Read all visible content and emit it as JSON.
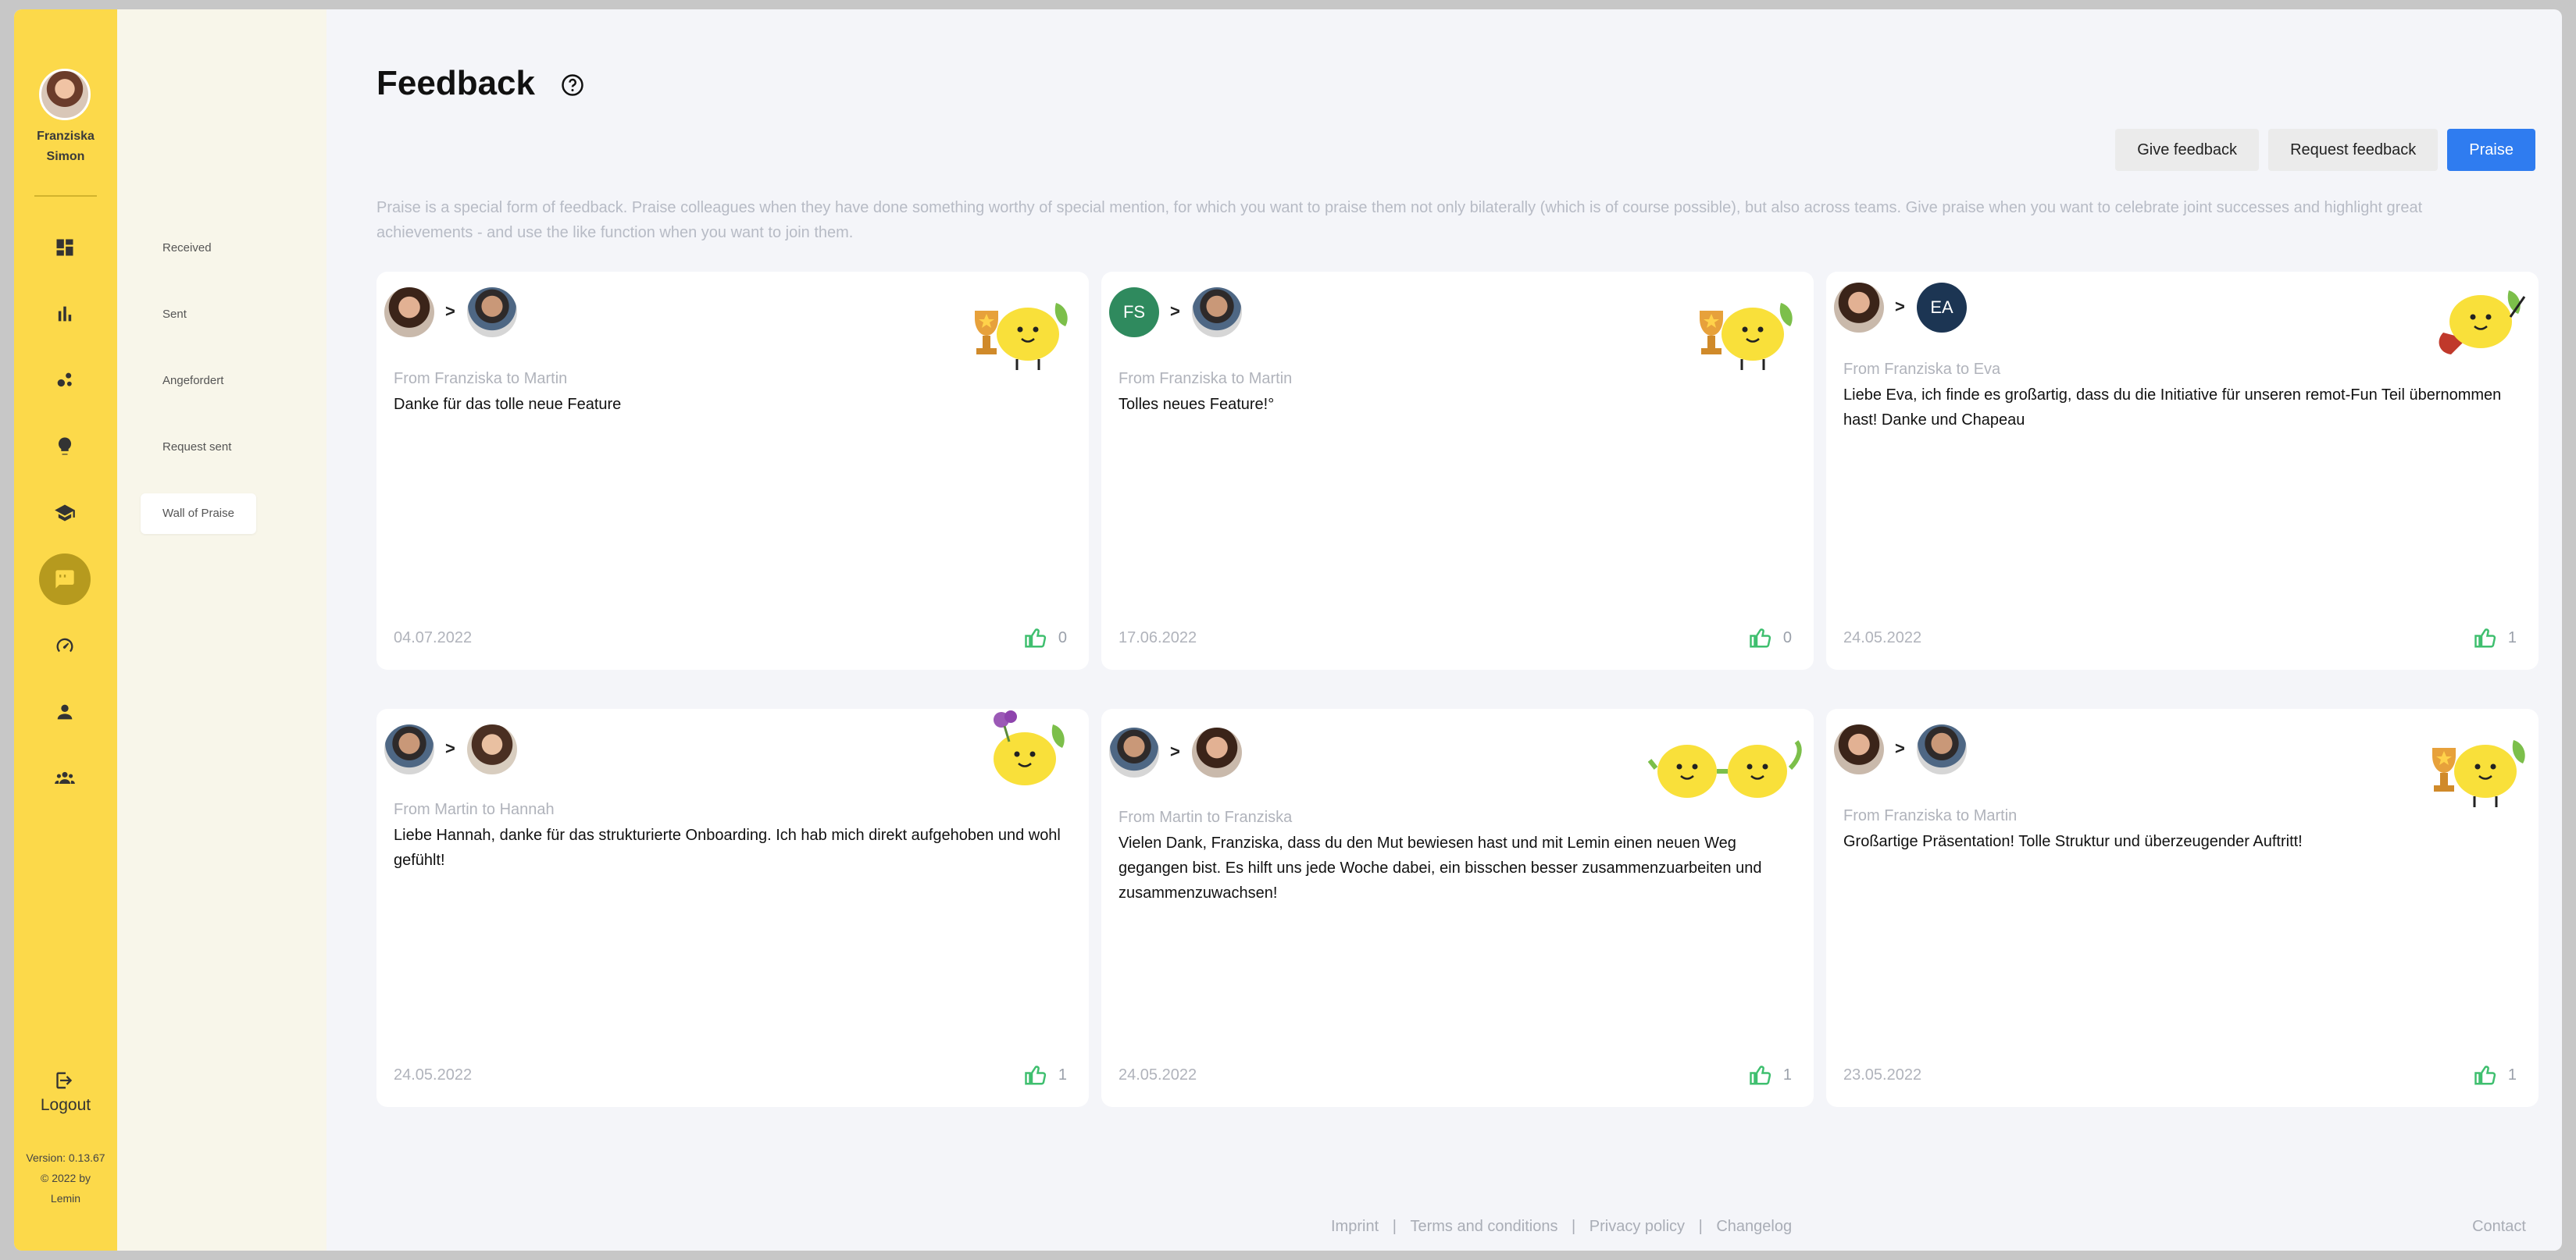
{
  "user": {
    "name_line1": "Franziska",
    "name_line2": "Simon"
  },
  "rail_icons": [
    "dashboard-icon",
    "bar-chart-icon",
    "network-icon",
    "lightbulb-icon",
    "graduation-cap-icon",
    "feedback-chat-icon",
    "gauge-icon",
    "person-icon",
    "team-icon"
  ],
  "logout": {
    "label": "Logout"
  },
  "version": {
    "line1": "Version: 0.13.67",
    "line2": "© 2022 by",
    "line3": "Lemin"
  },
  "subnav": {
    "items": [
      {
        "label": "Received"
      },
      {
        "label": "Sent"
      },
      {
        "label": "Angefordert"
      },
      {
        "label": "Request sent"
      },
      {
        "label": "Wall of Praise",
        "active": true
      }
    ]
  },
  "header": {
    "title": "Feedback"
  },
  "actions": {
    "give": "Give feedback",
    "request": "Request feedback",
    "praise": "Praise"
  },
  "intro": "Praise is a special form of feedback. Praise colleagues when they have done something worthy of special mention, for which you want to praise them not only bilaterally (which is of course possible), but also across teams. Give praise when you want to celebrate joint successes and highlight great achievements - and use the like function when you want to join them.",
  "cards": [
    {
      "from_to": "From Franziska to Martin",
      "message": "Danke für das tolle neue Feature",
      "date": "04.07.2022",
      "likes": "0"
    },
    {
      "from_to": "From Franziska to Martin",
      "sender_initials": "FS",
      "message": "Tolles neues Feature!°",
      "date": "17.06.2022",
      "likes": "0"
    },
    {
      "from_to": "From Franziska to Eva",
      "receiver_initials": "EA",
      "message": "Liebe Eva, ich finde es großartig, dass du die Initiative für unseren remot-Fun Teil übernommen hast! Danke und Chapeau",
      "date": "24.05.2022",
      "likes": "1"
    },
    {
      "from_to": "From Martin to Hannah",
      "message": "Liebe Hannah, danke für das strukturierte Onboarding. Ich hab mich direkt aufgehoben und wohl gefühlt!",
      "date": "24.05.2022",
      "likes": "1"
    },
    {
      "from_to": "From Martin to Franziska",
      "message": "Vielen Dank, Franziska, dass du den Mut bewiesen hast und mit Lemin einen neuen Weg gegangen bist. Es hilft uns jede Woche dabei, ein bisschen besser zusammenzuarbeiten und zusammenzuwachsen!",
      "date": "24.05.2022",
      "likes": "1"
    },
    {
      "from_to": "From Franziska to Martin",
      "message": "Großartige Präsentation! Tolle Struktur und überzeugender Auftritt!",
      "date": "23.05.2022",
      "likes": "1"
    }
  ],
  "footer": {
    "imprint": "Imprint",
    "terms": "Terms and conditions",
    "privacy": "Privacy policy",
    "changelog": "Changelog",
    "contact": "Contact",
    "separator": "|"
  },
  "colors": {
    "rail": "#fcd94a",
    "accent": "#2f7cf0",
    "like": "#3fbf6f"
  }
}
